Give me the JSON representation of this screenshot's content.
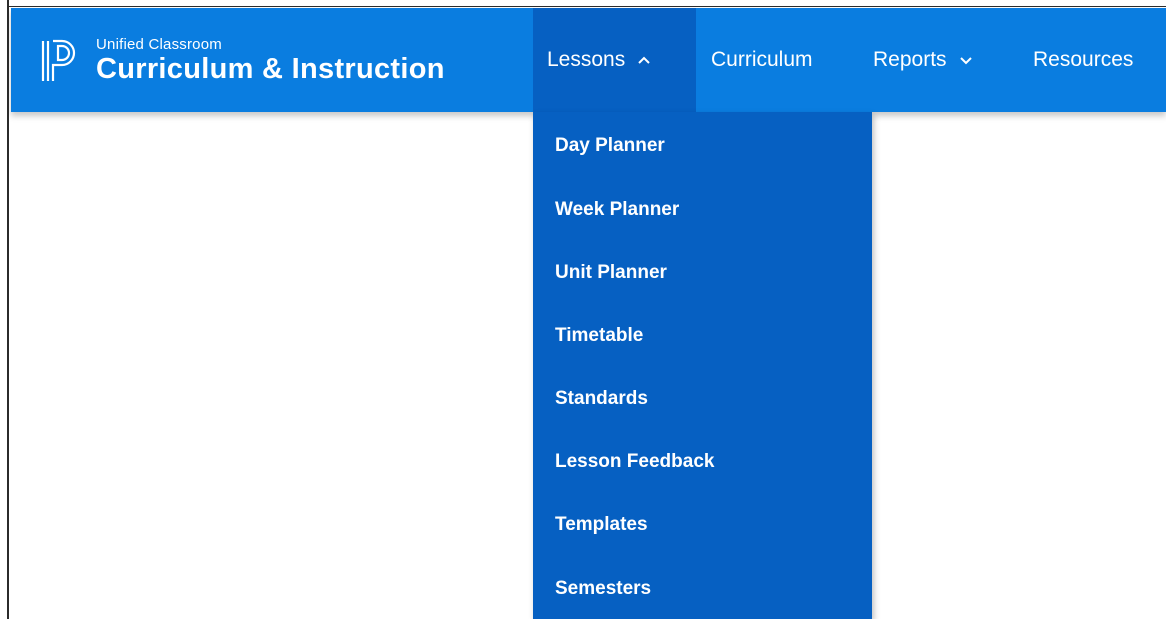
{
  "brand": {
    "subtitle": "Unified Classroom",
    "title": "Curriculum & Instruction"
  },
  "nav": {
    "items": [
      {
        "label": "Lessons",
        "state": "expanded"
      },
      {
        "label": "Curriculum"
      },
      {
        "label": "Reports",
        "state": "collapsed"
      },
      {
        "label": "Resources"
      }
    ]
  },
  "lessons_menu": {
    "items": [
      {
        "label": "Day Planner"
      },
      {
        "label": "Week Planner"
      },
      {
        "label": "Unit Planner"
      },
      {
        "label": "Timetable"
      },
      {
        "label": "Standards"
      },
      {
        "label": "Lesson Feedback"
      },
      {
        "label": "Templates"
      },
      {
        "label": "Semesters"
      }
    ]
  },
  "colors": {
    "navbar": "#0a7de0",
    "active_nav": "#0660c2",
    "dropdown": "#0660c2",
    "text": "#ffffff"
  },
  "icons": {
    "logo": "powerschool-logo",
    "lessons_chevron": "chevron-up-icon",
    "reports_chevron": "chevron-down-icon"
  }
}
